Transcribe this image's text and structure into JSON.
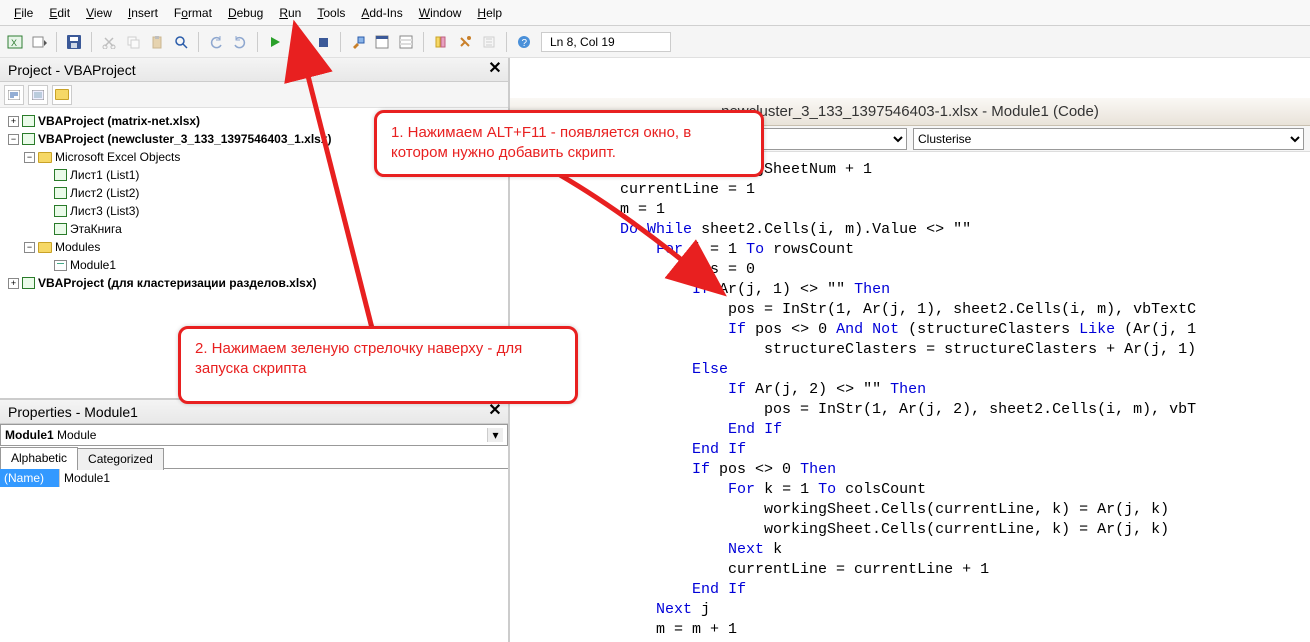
{
  "menu": [
    "File",
    "Edit",
    "View",
    "Insert",
    "Format",
    "Debug",
    "Run",
    "Tools",
    "Add-Ins",
    "Window",
    "Help"
  ],
  "status_pos": "Ln 8, Col 19",
  "project_panel": {
    "title": "Project - VBAProject",
    "tree": {
      "p1": "VBAProject (matrix-net.xlsx)",
      "p2": "VBAProject (newcluster_3_133_1397546403_1.xlsx)",
      "excel_objects": "Microsoft Excel Objects",
      "sheet1": "Лист1 (List1)",
      "sheet2": "Лист2 (List2)",
      "sheet3": "Лист3 (List3)",
      "thisbook": "ЭтаКнига",
      "modules": "Modules",
      "module1": "Module1",
      "p3": "VBAProject (для кластеризации разделов.xlsx)"
    }
  },
  "properties_panel": {
    "title": "Properties - Module1",
    "combo_label": "Module1",
    "combo_type": "Module",
    "tab_alpha": "Alphabetic",
    "tab_cat": "Categorized",
    "name_prop": "(Name)",
    "name_val": "Module1"
  },
  "code_window": {
    "title": "newcluster_3_133_1397546403-1.xlsx - Module1 (Code)",
    "combo_left": "",
    "combo_right": "Clusterise",
    "lines": [
      "(etNum = workingSheetNum + 1",
      "currentLine = 1",
      "m = 1",
      "Do While sheet2.Cells(i, m).Value <> \"\"",
      "    For j = 1 To rowsCount",
      "        pos = 0",
      "        If Ar(j, 1) <> \"\" Then",
      "            pos = InStr(1, Ar(j, 1), sheet2.Cells(i, m), vbTextC",
      "            If pos <> 0 And Not (structureClasters Like (Ar(j, 1",
      "                structureClasters = structureClasters + Ar(j, 1)",
      "        Else",
      "            If Ar(j, 2) <> \"\" Then",
      "                pos = InStr(1, Ar(j, 2), sheet2.Cells(i, m), vbT",
      "            End If",
      "        End If",
      "        If pos <> 0 Then",
      "            For k = 1 To colsCount",
      "                workingSheet.Cells(currentLine, k) = Ar(j, k)",
      "                workingSheet.Cells(currentLine, k) = Ar(j, k)",
      "            Next k",
      "            currentLine = currentLine + 1",
      "        End If",
      "    Next j",
      "    m = m + 1"
    ]
  },
  "callouts": {
    "c1": "1. Нажимаем ALT+F11  - появляется окно, в котором нужно добавить скрипт.",
    "c2": "2.  Нажимаем зеленую стрелочку наверху - для запуска скрипта"
  },
  "icons": {
    "excel": "X",
    "save": "💾",
    "cut": "✂",
    "copy": "⧉",
    "paste": "📋",
    "find": "🔍",
    "undo": "↶",
    "redo": "↷",
    "run": "▶",
    "pause": "⏸",
    "stop": "■",
    "design": "📐",
    "proj": "📁",
    "props": "🔧",
    "objbrow": "📚",
    "toolbox": "🧰",
    "help": "?"
  }
}
